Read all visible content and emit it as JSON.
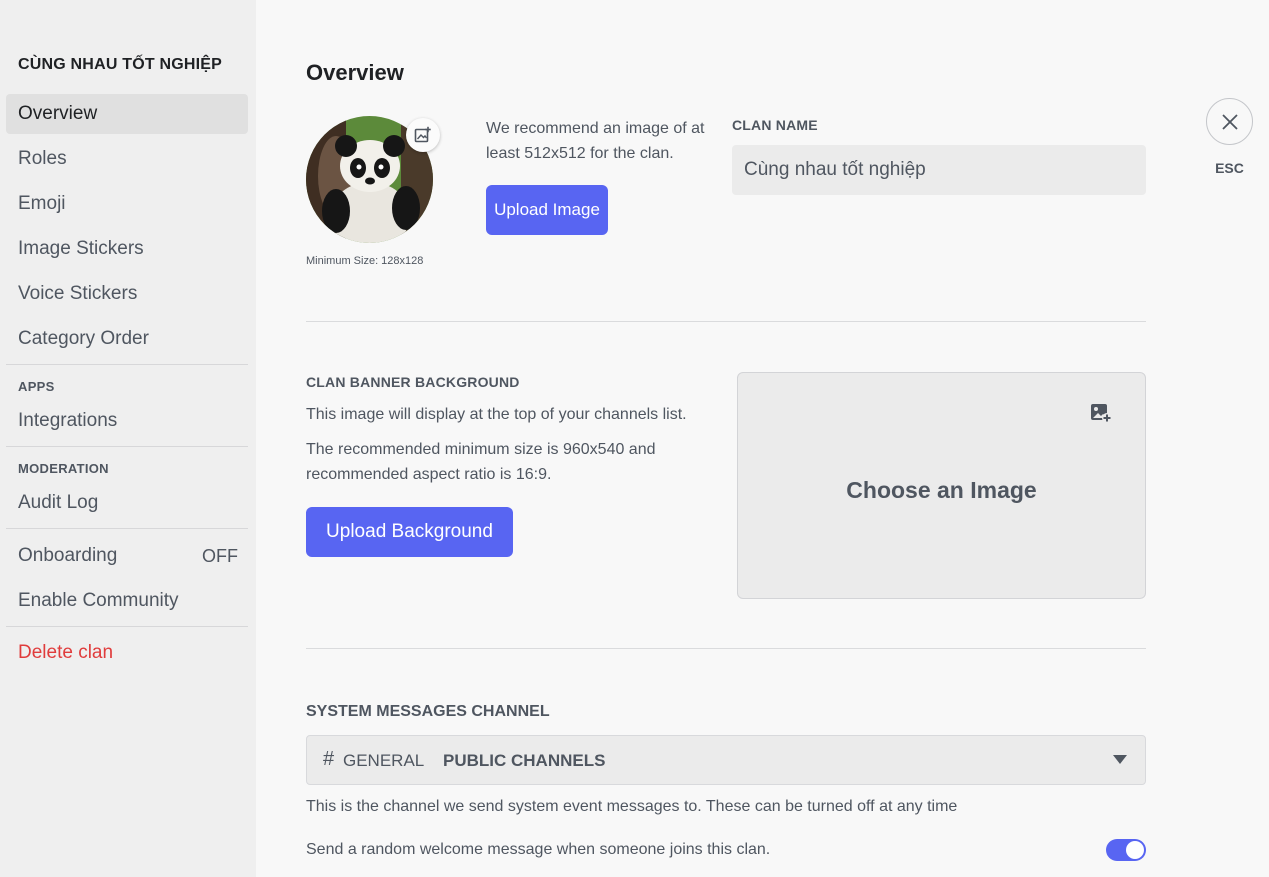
{
  "sidebar": {
    "clan_title": "CÙNG NHAU TỐT NGHIỆP",
    "items_top": [
      {
        "label": "Overview",
        "active": true
      },
      {
        "label": "Roles"
      },
      {
        "label": "Emoji"
      },
      {
        "label": "Image Stickers"
      },
      {
        "label": "Voice Stickers"
      },
      {
        "label": "Category Order"
      }
    ],
    "apps_section": "APPS",
    "apps_items": [
      {
        "label": "Integrations"
      }
    ],
    "moderation_section": "MODERATION",
    "moderation_items": [
      {
        "label": "Audit Log"
      }
    ],
    "onboarding": {
      "label": "Onboarding",
      "status": "OFF"
    },
    "enable_community": "Enable Community",
    "delete_clan": "Delete clan"
  },
  "main": {
    "title": "Overview",
    "avatar": {
      "min_size": "Minimum Size: 128x128",
      "icon": "add-image-icon"
    },
    "recommend_text": "We recommend an image of at least 512x512 for the clan.",
    "upload_image_label": "Upload Image",
    "clan_name": {
      "label": "CLAN NAME",
      "value": "Cùng nhau tốt nghiệp"
    },
    "close": {
      "icon": "close-icon",
      "label": "ESC"
    },
    "banner": {
      "label": "CLAN BANNER BACKGROUND",
      "desc1": "This image will display at the top of your channels list.",
      "desc2": "The recommended minimum size is 960x540 and recommended aspect ratio is 16:9.",
      "upload_label": "Upload Background",
      "choose_label": "Choose an Image",
      "icon": "add-image-icon"
    },
    "system_messages": {
      "label": "SYSTEM MESSAGES CHANNEL",
      "hash": "#",
      "channel": "GENERAL",
      "group": "PUBLIC CHANNELS",
      "help": "This is the channel we send system event messages to. These can be turned off at any time",
      "welcome_text": "Send a random welcome message when someone joins this clan.",
      "welcome_enabled": true
    }
  },
  "colors": {
    "accent": "#5865f2",
    "danger": "#e03c3c",
    "sidebar_bg": "#efefef",
    "page_bg": "#f8f8f8"
  }
}
